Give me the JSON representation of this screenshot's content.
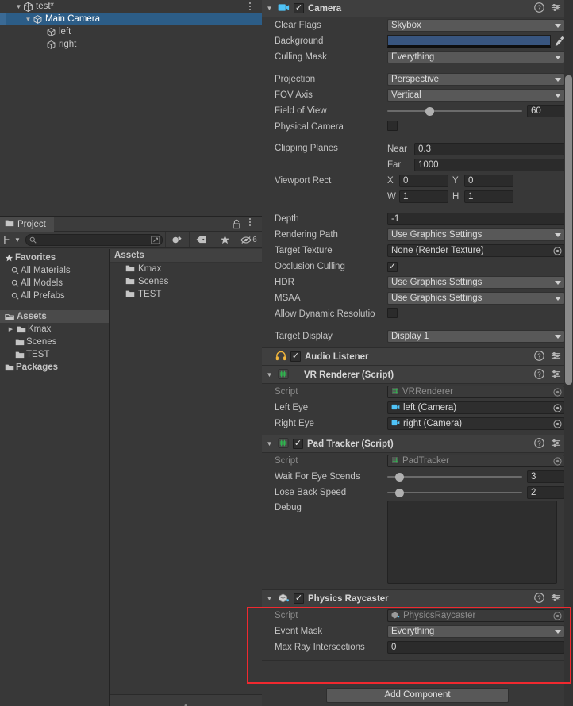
{
  "hierarchy": {
    "scene": "test*",
    "items": [
      {
        "label": "Main Camera",
        "depth": 1,
        "selected": true,
        "expandable": true,
        "icon": "cube-icon"
      },
      {
        "label": "left",
        "depth": 2,
        "selected": false,
        "expandable": false,
        "icon": "cube-icon"
      },
      {
        "label": "right",
        "depth": 2,
        "selected": false,
        "expandable": false,
        "icon": "cube-icon"
      }
    ]
  },
  "project": {
    "tab_label": "Project",
    "search_placeholder": "",
    "search_value": "",
    "hidden_count": "6",
    "tree": [
      {
        "label": "Favorites",
        "type": "header",
        "icon": "star-icon"
      },
      {
        "label": "All Materials",
        "type": "favorite",
        "icon": "search-icon"
      },
      {
        "label": "All Models",
        "type": "favorite",
        "icon": "search-icon"
      },
      {
        "label": "All Prefabs",
        "type": "favorite",
        "icon": "search-icon"
      },
      {
        "label": "Assets",
        "type": "root",
        "icon": "folder-open-icon",
        "active": true
      },
      {
        "label": "Kmax",
        "type": "folder",
        "icon": "folder-icon",
        "expandable": true
      },
      {
        "label": "Scenes",
        "type": "folder",
        "icon": "folder-icon"
      },
      {
        "label": "TEST",
        "type": "folder",
        "icon": "folder-icon"
      },
      {
        "label": "Packages",
        "type": "root",
        "icon": "folder-icon"
      }
    ],
    "breadcrumb": "Assets",
    "assets": [
      {
        "label": "Kmax",
        "icon": "folder-icon"
      },
      {
        "label": "Scenes",
        "icon": "folder-icon"
      },
      {
        "label": "TEST",
        "icon": "folder-icon"
      }
    ]
  },
  "inspector": {
    "add_component_label": "Add Component",
    "components": [
      {
        "name": "Camera",
        "icon": "camera-icon",
        "enabled": true,
        "expanded": true
      },
      {
        "name": "Audio Listener",
        "icon": "headphones-icon",
        "enabled": true,
        "expanded": false
      },
      {
        "name": "VR Renderer (Script)",
        "icon": "script-icon",
        "enabled": null,
        "expanded": true
      },
      {
        "name": "Pad Tracker (Script)",
        "icon": "script-icon",
        "enabled": true,
        "expanded": true
      },
      {
        "name": "Physics Raycaster",
        "icon": "raycaster-icon",
        "enabled": true,
        "expanded": true,
        "highlighted": true
      }
    ],
    "camera": {
      "clear_flags_label": "Clear Flags",
      "clear_flags_value": "Skybox",
      "background_label": "Background",
      "background_color": "#38557f",
      "culling_mask_label": "Culling Mask",
      "culling_mask_value": "Everything",
      "projection_label": "Projection",
      "projection_value": "Perspective",
      "fov_axis_label": "FOV Axis",
      "fov_axis_value": "Vertical",
      "field_of_view_label": "Field of View",
      "field_of_view_value": "60",
      "field_of_view_pct": 28,
      "physical_camera_label": "Physical Camera",
      "physical_camera_checked": false,
      "clipping_planes_label": "Clipping Planes",
      "near_label": "Near",
      "near_value": "0.3",
      "far_label": "Far",
      "far_value": "1000",
      "viewport_rect_label": "Viewport Rect",
      "viewport_x_label": "X",
      "viewport_x_value": "0",
      "viewport_y_label": "Y",
      "viewport_y_value": "0",
      "viewport_w_label": "W",
      "viewport_w_value": "1",
      "viewport_h_label": "H",
      "viewport_h_value": "1",
      "depth_label": "Depth",
      "depth_value": "-1",
      "rendering_path_label": "Rendering Path",
      "rendering_path_value": "Use Graphics Settings",
      "target_texture_label": "Target Texture",
      "target_texture_value": "None (Render Texture)",
      "occlusion_culling_label": "Occlusion Culling",
      "occlusion_culling_checked": true,
      "hdr_label": "HDR",
      "hdr_value": "Use Graphics Settings",
      "msaa_label": "MSAA",
      "msaa_value": "Use Graphics Settings",
      "allow_dynamic_resolution_label": "Allow Dynamic Resolutio",
      "allow_dynamic_resolution_checked": false,
      "target_display_label": "Target Display",
      "target_display_value": "Display 1"
    },
    "vr_renderer": {
      "script_label": "Script",
      "script_value": "VRRenderer",
      "left_eye_label": "Left Eye",
      "left_eye_value": "left (Camera)",
      "right_eye_label": "Right Eye",
      "right_eye_value": "right (Camera)"
    },
    "pad_tracker": {
      "script_label": "Script",
      "script_value": "PadTracker",
      "wait_for_eye_scends_label": "Wait For Eye Scends",
      "wait_for_eye_scends_value": "3",
      "wait_for_eye_scends_pct": 8,
      "lose_back_speed_label": "Lose Back Speed",
      "lose_back_speed_value": "2",
      "lose_back_speed_pct": 8,
      "debug_label": "Debug",
      "debug_value": ""
    },
    "physics_raycaster": {
      "script_label": "Script",
      "script_value": "PhysicsRaycaster",
      "event_mask_label": "Event Mask",
      "event_mask_value": "Everything",
      "max_ray_intersections_label": "Max Ray Intersections",
      "max_ray_intersections_value": "0",
      "highlight_color": "#f0292f"
    }
  }
}
